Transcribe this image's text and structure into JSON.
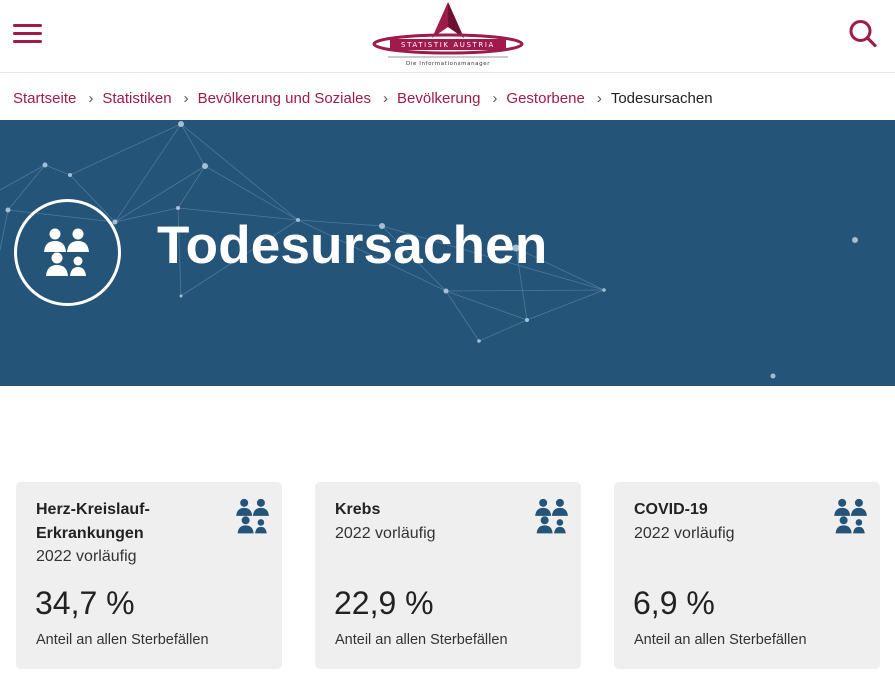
{
  "header": {
    "menu_icon": "hamburger-menu-icon",
    "logo": {
      "name": "STATISTIK AUSTRIA",
      "tagline": "Die Informationsmanager",
      "colors": {
        "primary": "#9e1b4b"
      }
    },
    "search_icon": "search-icon"
  },
  "breadcrumb": {
    "items": [
      "Startseite",
      "Statistiken",
      "Bevölkerung und Soziales",
      "Bevölkerung",
      "Gestorbene"
    ],
    "separator": "›",
    "current": "Todesursachen"
  },
  "hero": {
    "title": "Todesursachen",
    "icon": "population-group-icon",
    "background_color": "#255479"
  },
  "cards": [
    {
      "title": "Herz-Kreislauf-Erkrankungen",
      "year": "2022 vorläufig",
      "value": "34,7 %",
      "description": "Anteil an allen Sterbefällen",
      "icon": "population-group-icon"
    },
    {
      "title": "Krebs",
      "year": "2022 vorläufig",
      "value": "22,9 %",
      "description": "Anteil an allen Sterbefällen",
      "icon": "population-group-icon"
    },
    {
      "title": "COVID-19",
      "year": "2022 vorläufig",
      "value": "6,9 %",
      "description": "Anteil an allen Sterbefällen",
      "icon": "population-group-icon"
    }
  ],
  "colors": {
    "accent": "#9e1b4b",
    "hero": "#255479",
    "card_bg": "#efefef",
    "icon_blue": "#255479"
  }
}
